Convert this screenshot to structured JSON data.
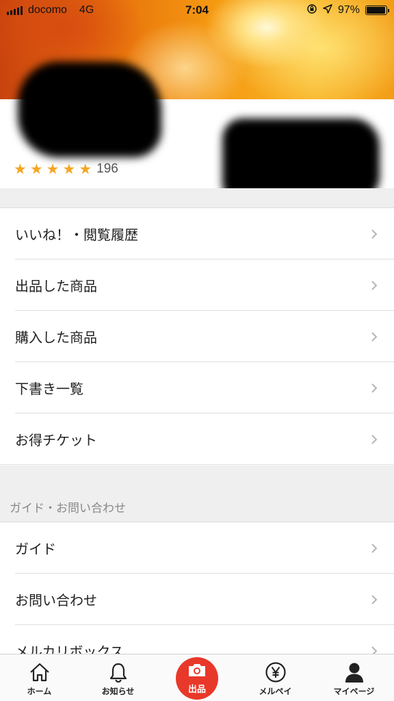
{
  "status_bar": {
    "carrier": "docomo",
    "network": "4G",
    "time": "7:04",
    "battery_percent": "97%",
    "battery_level": 0.97,
    "icons": [
      "signal-icon",
      "orientation-lock-icon",
      "location-arrow-icon",
      "battery-icon"
    ]
  },
  "profile": {
    "rating_stars": 5,
    "rating_count": "196"
  },
  "menu_main": [
    {
      "label": "いいね！・閲覧履歴"
    },
    {
      "label": "出品した商品"
    },
    {
      "label": "購入した商品"
    },
    {
      "label": "下書き一覧"
    },
    {
      "label": "お得チケット"
    }
  ],
  "guide_section": {
    "header": "ガイド・お問い合わせ",
    "items": [
      {
        "label": "ガイド"
      },
      {
        "label": "お問い合わせ"
      },
      {
        "label": "メルカリボックス"
      }
    ]
  },
  "tabbar": {
    "home": "ホーム",
    "notifications": "お知らせ",
    "sell": "出品",
    "merpay": "メルペイ",
    "mypage": "マイページ",
    "sell_color": "#e83829"
  }
}
